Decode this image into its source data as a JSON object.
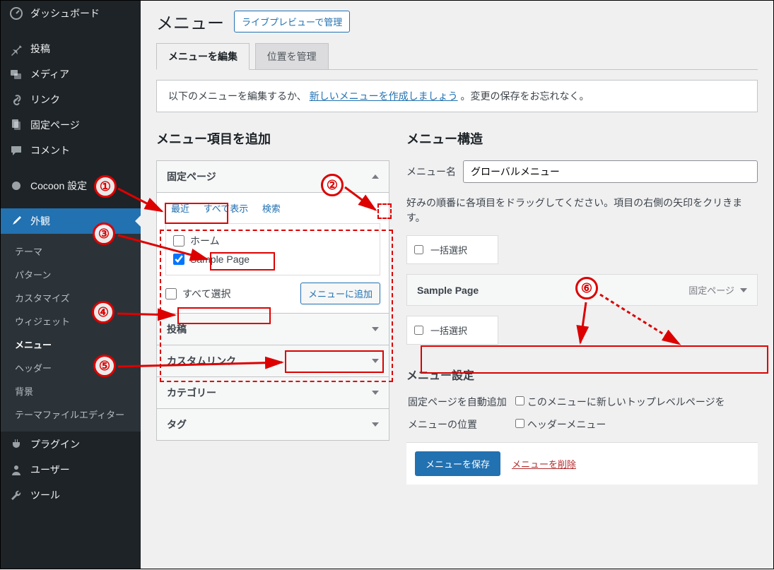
{
  "sidebar": {
    "items": [
      {
        "label": "ダッシュボード"
      },
      {
        "label": "投稿"
      },
      {
        "label": "メディア"
      },
      {
        "label": "リンク"
      },
      {
        "label": "固定ページ"
      },
      {
        "label": "コメント"
      },
      {
        "label": "Cocoon 設定"
      },
      {
        "label": "外観"
      },
      {
        "label": "プラグイン"
      },
      {
        "label": "ユーザー"
      },
      {
        "label": "ツール"
      }
    ],
    "submenu": [
      {
        "label": "テーマ"
      },
      {
        "label": "パターン"
      },
      {
        "label": "カスタマイズ"
      },
      {
        "label": "ウィジェット"
      },
      {
        "label": "メニュー"
      },
      {
        "label": "ヘッダー"
      },
      {
        "label": "背景"
      },
      {
        "label": "テーマファイルエディター"
      }
    ]
  },
  "header": {
    "title": "メニュー",
    "live_preview_btn": "ライブプレビューで管理"
  },
  "tabs": {
    "edit": "メニューを編集",
    "locations": "位置を管理"
  },
  "notice": {
    "prefix": "以下のメニューを編集するか、",
    "link": "新しいメニューを作成しましょう",
    "suffix": "。変更の保存をお忘れなく。"
  },
  "left": {
    "title": "メニュー項目を追加",
    "pages": {
      "header": "固定ページ",
      "subtabs": {
        "recent": "最近",
        "all": "すべて表示",
        "search": "検索"
      },
      "items": [
        {
          "label": "ホーム",
          "checked": false
        },
        {
          "label": "Sample Page",
          "checked": true
        }
      ],
      "select_all": "すべて選択",
      "add_btn": "メニューに追加"
    },
    "posts": "投稿",
    "custom_links": "カスタムリンク",
    "categories": "カテゴリー",
    "tags": "タグ"
  },
  "right": {
    "title": "メニュー構造",
    "name_label": "メニュー名",
    "name_value": "グローバルメニュー",
    "instructions": "好みの順番に各項目をドラッグしてください。項目の右側の矢印をクリきます。",
    "bulk_select": "一括選択",
    "menu_item": {
      "title": "Sample Page",
      "type": "固定ページ"
    },
    "settings_title": "メニュー設定",
    "auto_add_label": "固定ページを自動追加",
    "auto_add_desc": "このメニューに新しいトップレベルページを",
    "location_label": "メニューの位置",
    "location_opt": "ヘッダーメニュー",
    "save_btn": "メニューを保存",
    "delete_link": "メニューを削除"
  }
}
